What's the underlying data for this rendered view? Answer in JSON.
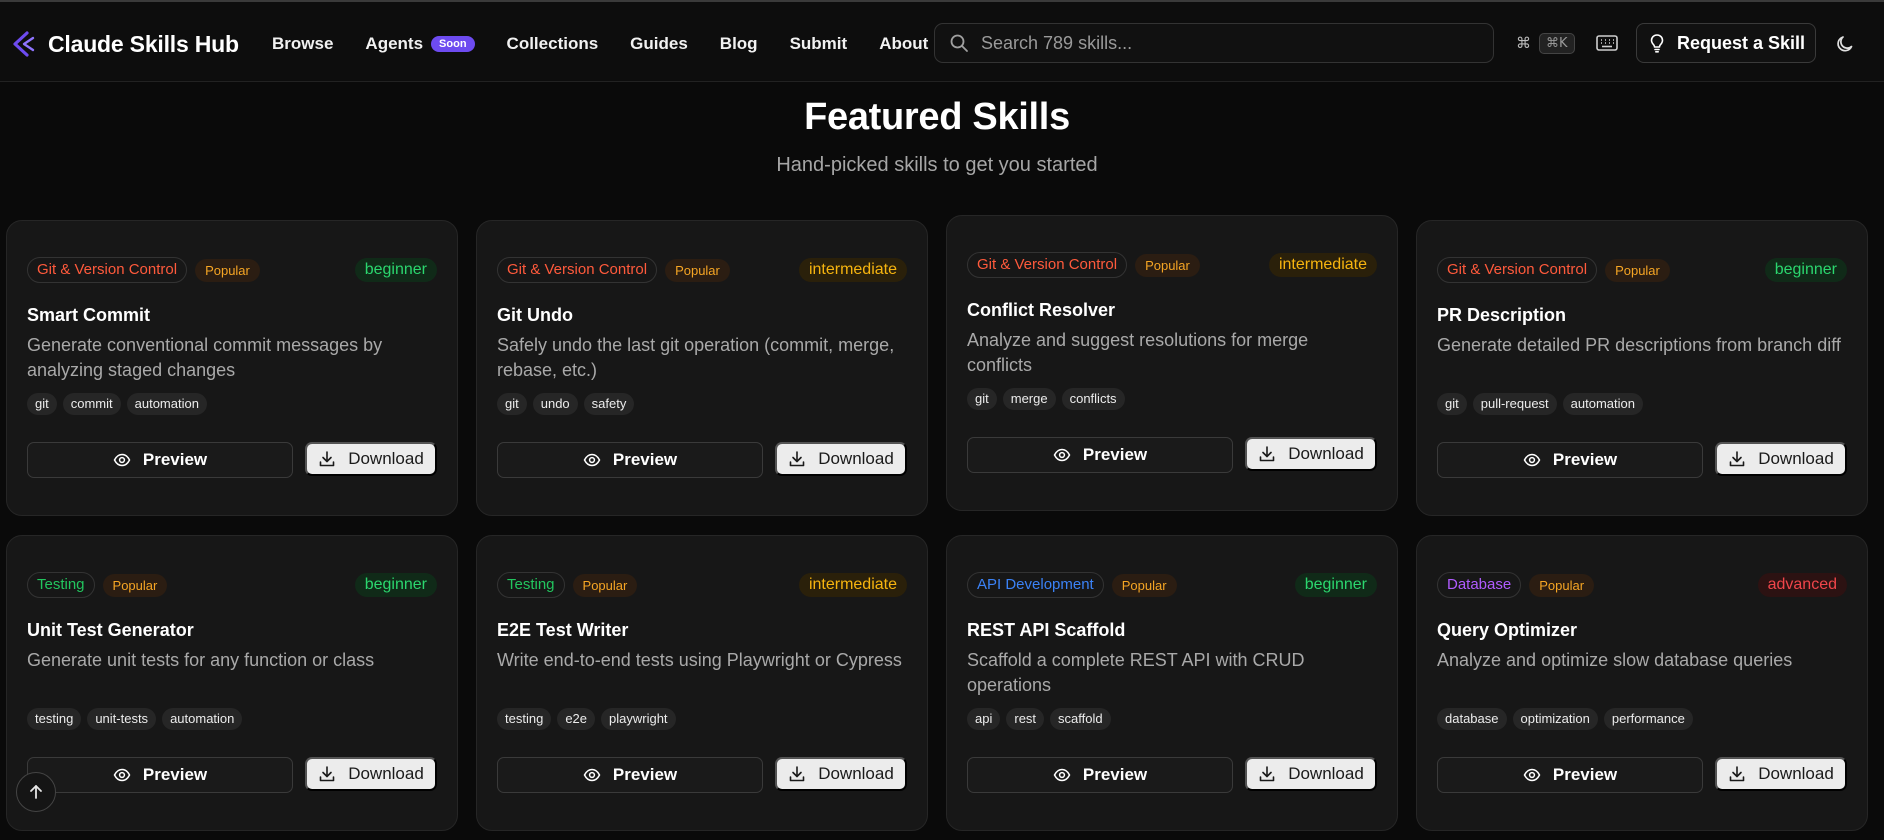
{
  "brand": {
    "name": "Claude Skills Hub",
    "icon": "chevron-logo-icon",
    "accent": "#6d4bf0"
  },
  "nav": {
    "items": [
      {
        "label": "Browse"
      },
      {
        "label": "Agents",
        "badge": "Soon"
      },
      {
        "label": "Collections"
      },
      {
        "label": "Guides"
      },
      {
        "label": "Blog"
      },
      {
        "label": "Submit"
      },
      {
        "label": "About"
      }
    ]
  },
  "search": {
    "placeholder": "Search 789 skills...",
    "shortcut_symbol": "⌘",
    "shortcut_key": "⌘K"
  },
  "header_actions": {
    "request_label": "Request a Skill"
  },
  "section": {
    "title": "Featured Skills",
    "subtitle": "Hand-picked skills to get you started"
  },
  "button_labels": {
    "preview": "Preview",
    "download": "Download"
  },
  "colors": {
    "git": "#ff5a3c",
    "testing": "#22c55e",
    "api": "#3b82f6",
    "database": "#b05cff",
    "popular": "#f5a524",
    "beginner": "#2bd66e",
    "intermediate": "#f6b40f",
    "advanced": "#f0454a"
  },
  "cards": [
    {
      "category": "Git & Version Control",
      "popular": "Popular",
      "level": "beginner",
      "title": "Smart Commit",
      "description": "Generate conventional commit messages by analyzing staged changes",
      "tags": [
        "git",
        "commit",
        "automation"
      ]
    },
    {
      "category": "Git & Version Control",
      "popular": "Popular",
      "level": "intermediate",
      "title": "Git Undo",
      "description": "Safely undo the last git operation (commit, merge, rebase, etc.)",
      "tags": [
        "git",
        "undo",
        "safety"
      ]
    },
    {
      "category": "Git & Version Control",
      "popular": "Popular",
      "level": "intermediate",
      "title": "Conflict Resolver",
      "description": "Analyze and suggest resolutions for merge conflicts",
      "tags": [
        "git",
        "merge",
        "conflicts"
      ]
    },
    {
      "category": "Git & Version Control",
      "popular": "Popular",
      "level": "beginner",
      "title": "PR Description",
      "description": "Generate detailed PR descriptions from branch diff",
      "tags": [
        "git",
        "pull-request",
        "automation"
      ]
    },
    {
      "category": "Testing",
      "popular": "Popular",
      "level": "beginner",
      "title": "Unit Test Generator",
      "description": "Generate unit tests for any function or class",
      "tags": [
        "testing",
        "unit-tests",
        "automation"
      ]
    },
    {
      "category": "Testing",
      "popular": "Popular",
      "level": "intermediate",
      "title": "E2E Test Writer",
      "description": "Write end-to-end tests using Playwright or Cypress",
      "tags": [
        "testing",
        "e2e",
        "playwright"
      ]
    },
    {
      "category": "API Development",
      "popular": "Popular",
      "level": "beginner",
      "title": "REST API Scaffold",
      "description": "Scaffold a complete REST API with CRUD operations",
      "tags": [
        "api",
        "rest",
        "scaffold"
      ]
    },
    {
      "category": "Database",
      "popular": "Popular",
      "level": "advanced",
      "title": "Query Optimizer",
      "description": "Analyze and optimize slow database queries",
      "tags": [
        "database",
        "optimization",
        "performance"
      ]
    }
  ]
}
